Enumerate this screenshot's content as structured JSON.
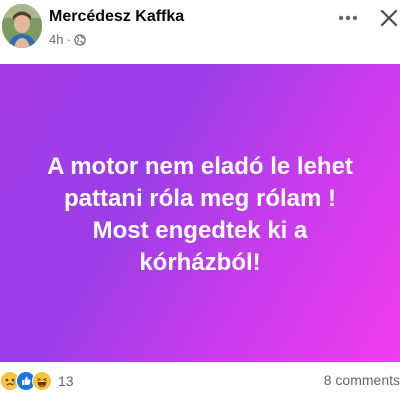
{
  "header": {
    "author_name": "Mercédesz Kaffka",
    "timestamp": "4h",
    "separator": "·",
    "privacy_icon": "globe-icon",
    "more_icon": "more-options-icon",
    "close_icon": "close-icon"
  },
  "post": {
    "text": "A motor nem eladó le lehet pattani róla meg rólam ! Most engedtek ki a kórházból!",
    "background_colors": [
      "#a53ae6",
      "#9a3ee8",
      "#c83cec",
      "#f03cf0"
    ],
    "text_color": "#ffffff"
  },
  "footer": {
    "reaction_icons": [
      "sad-icon",
      "like-icon",
      "haha-icon"
    ],
    "reaction_count": "13",
    "comments_label": "8 comments"
  }
}
